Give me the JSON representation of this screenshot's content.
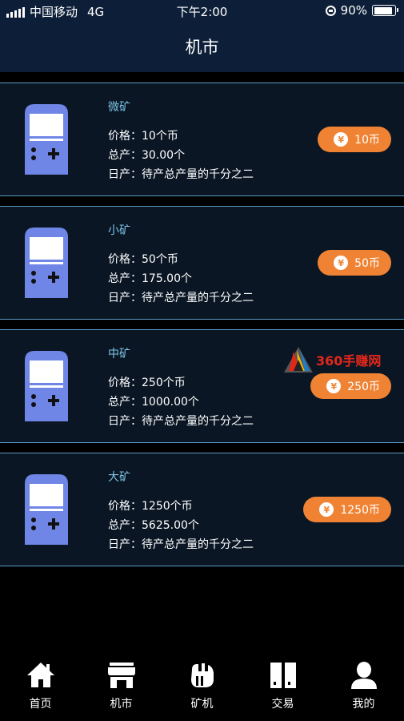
{
  "status_bar": {
    "carrier": "中国移动",
    "network": "4G",
    "time": "下午2:00",
    "battery": "90%",
    "battery_level": 0.9
  },
  "nav": {
    "title": "机市"
  },
  "currency_symbol": "¥",
  "field_labels": {
    "price": "价格：",
    "total": "总产：",
    "daily": "日产："
  },
  "items": [
    {
      "name": "微矿",
      "price": "10个币",
      "total": "30.00个",
      "daily": "待产总产量的千分之二",
      "button": "10币"
    },
    {
      "name": "小矿",
      "price": "50个币",
      "total": "175.00个",
      "daily": "待产总产量的千分之二",
      "button": "50币"
    },
    {
      "name": "中矿",
      "price": "250个币",
      "total": "1000.00个",
      "daily": "待产总产量的千分之二",
      "button": "250币"
    },
    {
      "name": "大矿",
      "price": "1250个币",
      "total": "5625.00个",
      "daily": "待产总产量的千分之二",
      "button": "1250币"
    }
  ],
  "watermark": {
    "text": "360手赚网"
  },
  "tabs": [
    {
      "label": "首页",
      "icon": "home-icon"
    },
    {
      "label": "机市",
      "icon": "store-icon"
    },
    {
      "label": "矿机",
      "icon": "miner-icon"
    },
    {
      "label": "交易",
      "icon": "trade-icon"
    },
    {
      "label": "我的",
      "icon": "user-icon"
    }
  ],
  "colors": {
    "header_bg": "#0d1f38",
    "card_bg": "#0a1624",
    "card_border": "#5a9bc4",
    "item_name": "#7fc6e8",
    "button": "#f08333",
    "device_icon": "#6f86e6"
  }
}
